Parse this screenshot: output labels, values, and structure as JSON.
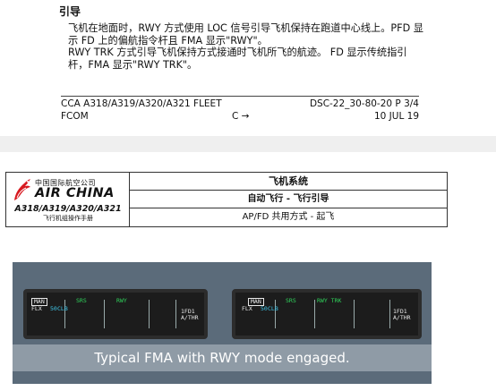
{
  "fcom": {
    "heading": "引导",
    "paragraph": "飞机在地面时，RWY 方式使用 LOC 信号引导飞机保持在跑道中心线上。PFD 显\n示 FD 上的偏航指令杆且 FMA 显示\"RWY\"。\nRWY TRK 方式引导飞机保持方式接通时飞机所飞的航迹。 FD 显示传统指引\n杆，FMA 显示\"RWY TRK\"。",
    "footer": {
      "fleet": "CCA A318/A319/A320/A321 FLEET",
      "doc": "FCOM",
      "center": "C →",
      "ref": "DSC-22_30-80-20 P 3/4",
      "date": "10 JUL 19"
    }
  },
  "airchina": {
    "logo_cn": "中国国际航空公司",
    "logo_en": "AIR CHINA",
    "models": "A318/A319/A320/A321",
    "manual": "飞行机组操作手册",
    "system_title": "飞机系统",
    "subtitle": "自动飞行 - 飞行引导",
    "section": "AP/FD 共用方式 - 起飞",
    "brand_red": "#d71920"
  },
  "figure": {
    "fma_left": {
      "man": "MAN",
      "flx": "FLX",
      "flx_temp": "50",
      "clb": "CLB",
      "srs": "SRS",
      "lat": "RWY",
      "fd": "1FD1",
      "athr": "A/THR"
    },
    "fma_right": {
      "man": "MAN",
      "flx": "FLX",
      "flx_temp": "50",
      "clb": "CLB",
      "srs": "SRS",
      "lat": "RWY TRK",
      "fd": "1FD1",
      "athr": "A/THR"
    },
    "caption": "Typical FMA with RWY mode engaged."
  }
}
